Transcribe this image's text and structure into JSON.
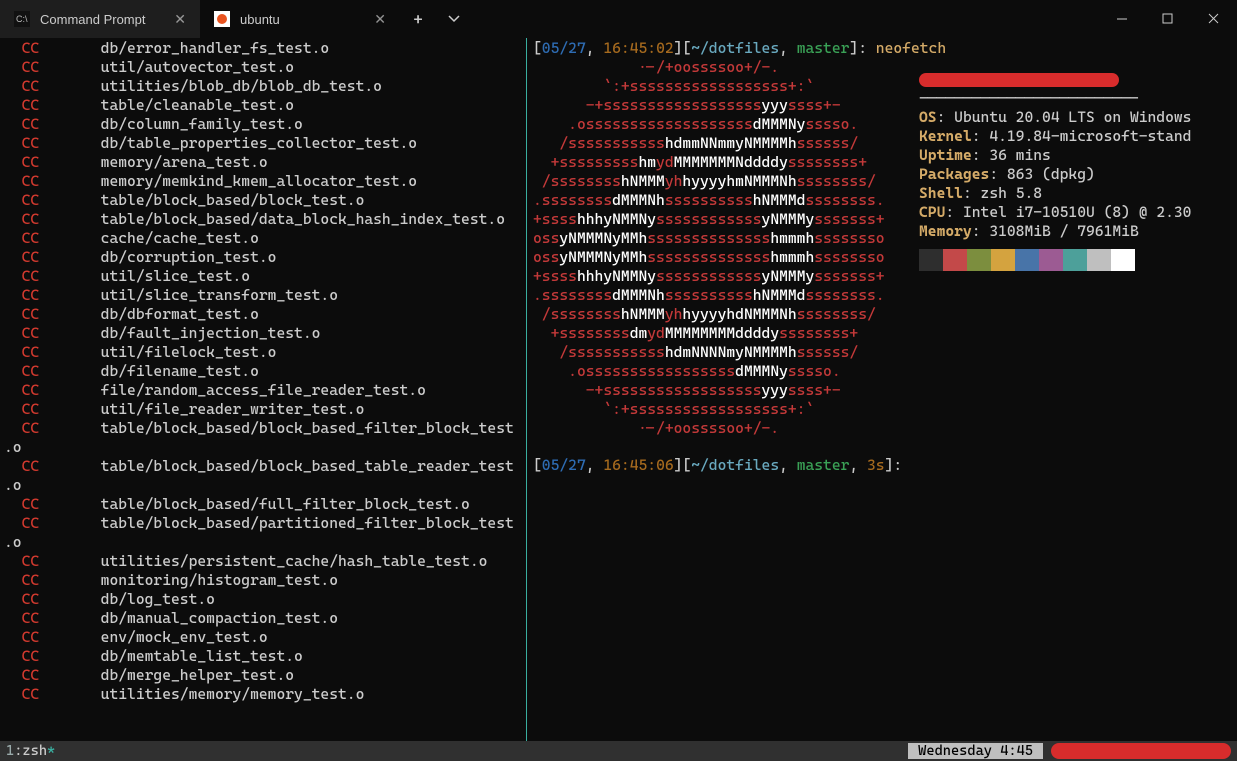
{
  "titlebar": {
    "tabs": [
      {
        "label": "Command Prompt",
        "active": false
      },
      {
        "label": "ubuntu",
        "active": true
      }
    ]
  },
  "left_pane": {
    "cc_label": "CC",
    "lines": [
      "db/error_handler_fs_test.o",
      "util/autovector_test.o",
      "utilities/blob_db/blob_db_test.o",
      "table/cleanable_test.o",
      "db/column_family_test.o",
      "db/table_properties_collector_test.o",
      "memory/arena_test.o",
      "memory/memkind_kmem_allocator_test.o",
      "table/block_based/block_test.o",
      "table/block_based/data_block_hash_index_test.o",
      "cache/cache_test.o",
      "db/corruption_test.o",
      "util/slice_test.o",
      "util/slice_transform_test.o",
      "db/dbformat_test.o",
      "db/fault_injection_test.o",
      "util/filelock_test.o",
      "db/filename_test.o",
      "file/random_access_file_reader_test.o",
      "util/file_reader_writer_test.o",
      "table/block_based/block_based_filter_block_test",
      ".o",
      "table/block_based/block_based_table_reader_test",
      ".o",
      "table/block_based/full_filter_block_test.o",
      "table/block_based/partitioned_filter_block_test",
      ".o",
      "utilities/persistent_cache/hash_table_test.o",
      "monitoring/histogram_test.o",
      "db/log_test.o",
      "db/manual_compaction_test.o",
      "env/mock_env_test.o",
      "db/memtable_list_test.o",
      "db/merge_helper_test.o",
      "utilities/memory/memory_test.o"
    ]
  },
  "right_pane": {
    "prompt1": {
      "date": "05/27",
      "time": "16:45:02",
      "path": "~/dotfiles",
      "branch": "master",
      "cmd": "neofetch"
    },
    "prompt2": {
      "date": "05/27",
      "time": "16:45:06",
      "path": "~/dotfiles",
      "branch": "master",
      "duration": "3s"
    },
    "neofetch": {
      "dashes": "-------------------------",
      "os_label": "OS",
      "os": ": Ubuntu 20.04 LTS on Windows",
      "kernel_label": "Kernel",
      "kernel": ": 4.19.84-microsoft-stand",
      "uptime_label": "Uptime",
      "uptime": ": 36 mins",
      "packages_label": "Packages",
      "packages": ": 863 (dpkg)",
      "shell_label": "Shell",
      "shell": ": zsh 5.8",
      "cpu_label": "CPU",
      "cpu": ": Intel i7-10510U (8) @ 2.30",
      "memory_label": "Memory",
      "memory": ": 3108MiB / 7961MiB",
      "palette": [
        "#2e2e2e",
        "#c34949",
        "#7c8e3e",
        "#d4a33f",
        "#4874a8",
        "#9c5b93",
        "#4da09a",
        "#bfbfbf",
        "#ffffff"
      ]
    },
    "logo": [
      [
        [
          "r",
          "            .-/+oossssoo+/-."
        ]
      ],
      [
        [
          "r",
          "        `:+ssssssssssssssssss+:`"
        ]
      ],
      [
        [
          "r",
          "      -+ssssssssssssssssss"
        ],
        [
          "w",
          "yyy"
        ],
        [
          "r",
          "ssss+-"
        ]
      ],
      [
        [
          "r",
          "    .osssssssssssssssssss"
        ],
        [
          "w",
          "dMMMNy"
        ],
        [
          "r",
          "sssso."
        ]
      ],
      [
        [
          "r",
          "   /sssssssssss"
        ],
        [
          "w",
          "hdmmNNmmyNMMMMh"
        ],
        [
          "r",
          "ssssss/"
        ]
      ],
      [
        [
          "r",
          "  +sssssssss"
        ],
        [
          "w",
          "hm"
        ],
        [
          "r",
          "yd"
        ],
        [
          "w",
          "MMMMMMMNddddy"
        ],
        [
          "r",
          "ssssssss+"
        ]
      ],
      [
        [
          "r",
          " /ssssssss"
        ],
        [
          "w",
          "hNMMM"
        ],
        [
          "r",
          "yh"
        ],
        [
          "w",
          "hyyyyhmNMMMNh"
        ],
        [
          "r",
          "ssssssss/"
        ]
      ],
      [
        [
          "r",
          ".ssssssss"
        ],
        [
          "w",
          "dMMMNh"
        ],
        [
          "r",
          "ssssssssss"
        ],
        [
          "w",
          "hNMMMd"
        ],
        [
          "r",
          "ssssssss."
        ]
      ],
      [
        [
          "r",
          "+ssss"
        ],
        [
          "w",
          "hhhyNMMNy"
        ],
        [
          "r",
          "ssssssssssss"
        ],
        [
          "w",
          "yNMMMy"
        ],
        [
          "r",
          "sssssss+"
        ]
      ],
      [
        [
          "r",
          "oss"
        ],
        [
          "w",
          "yNMMMNyMMh"
        ],
        [
          "r",
          "ssssssssssssss"
        ],
        [
          "w",
          "hmmmh"
        ],
        [
          "r",
          "ssssssso"
        ]
      ],
      [
        [
          "r",
          "oss"
        ],
        [
          "w",
          "yNMMMNyMMh"
        ],
        [
          "r",
          "ssssssssssssss"
        ],
        [
          "w",
          "hmmmh"
        ],
        [
          "r",
          "ssssssso"
        ]
      ],
      [
        [
          "r",
          "+ssss"
        ],
        [
          "w",
          "hhhyNMMNy"
        ],
        [
          "r",
          "ssssssssssss"
        ],
        [
          "w",
          "yNMMMy"
        ],
        [
          "r",
          "sssssss+"
        ]
      ],
      [
        [
          "r",
          ".ssssssss"
        ],
        [
          "w",
          "dMMMNh"
        ],
        [
          "r",
          "ssssssssss"
        ],
        [
          "w",
          "hNMMMd"
        ],
        [
          "r",
          "ssssssss."
        ]
      ],
      [
        [
          "r",
          " /ssssssss"
        ],
        [
          "w",
          "hNMMM"
        ],
        [
          "r",
          "yh"
        ],
        [
          "w",
          "hyyyyhdNMMMNh"
        ],
        [
          "r",
          "ssssssss/"
        ]
      ],
      [
        [
          "r",
          "  +ssssssss"
        ],
        [
          "w",
          "dm"
        ],
        [
          "r",
          "yd"
        ],
        [
          "w",
          "MMMMMMMMddddy"
        ],
        [
          "r",
          "ssssssss+"
        ]
      ],
      [
        [
          "r",
          "   /sssssssssss"
        ],
        [
          "w",
          "hdmNNNNmyNMMMMh"
        ],
        [
          "r",
          "ssssss/"
        ]
      ],
      [
        [
          "r",
          "    .osssssssssssssssss"
        ],
        [
          "w",
          "dMMMNy"
        ],
        [
          "r",
          "sssso."
        ]
      ],
      [
        [
          "r",
          "      -+ssssssssssssssssss"
        ],
        [
          "w",
          "yyy"
        ],
        [
          "r",
          "ssss+-"
        ]
      ],
      [
        [
          "r",
          "        `:+ssssssssssssssssss+:`"
        ]
      ],
      [
        [
          "r",
          "            .-/+oossssoo+/-."
        ]
      ]
    ]
  },
  "statusbar": {
    "index": "1",
    "sep": ":",
    "proc": "zsh",
    "star": "*",
    "date": "Wednesday 4:45"
  }
}
